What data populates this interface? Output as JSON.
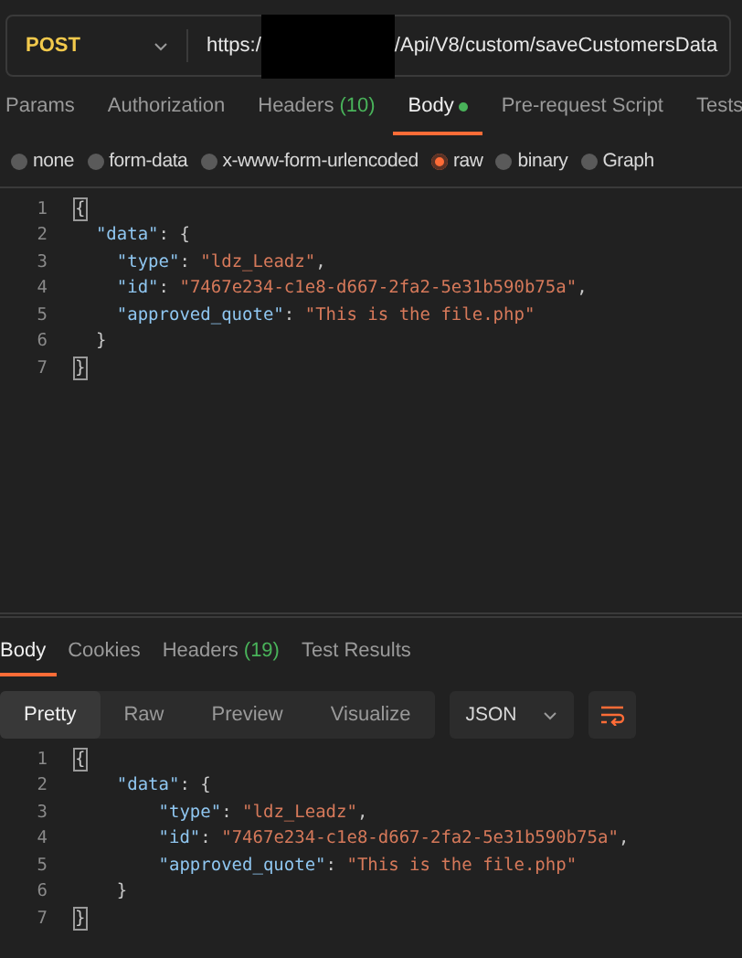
{
  "request": {
    "method": "POST",
    "url_prefix": "https:/",
    "url_suffix": "/Api/V8/custom/saveCustomersData"
  },
  "request_tabs": [
    {
      "label": "Params",
      "selected": false
    },
    {
      "label": "Authorization",
      "selected": false
    },
    {
      "label": "Headers",
      "count": "(10)",
      "selected": false
    },
    {
      "label": "Body",
      "selected": true,
      "dot": true
    },
    {
      "label": "Pre-request Script",
      "selected": false
    },
    {
      "label": "Tests",
      "selected": false
    }
  ],
  "body_types": [
    {
      "label": "none",
      "selected": false
    },
    {
      "label": "form-data",
      "selected": false
    },
    {
      "label": "x-www-form-urlencoded",
      "selected": false
    },
    {
      "label": "raw",
      "selected": true
    },
    {
      "label": "binary",
      "selected": false
    },
    {
      "label": "Graph",
      "selected": false
    }
  ],
  "request_body": [
    {
      "number": "1",
      "tokens": [
        {
          "kind": "match",
          "text": "{"
        }
      ]
    },
    {
      "number": "2",
      "tokens": [
        {
          "kind": "key",
          "text": "\"data\""
        },
        {
          "kind": "plain",
          "text": ": {"
        }
      ]
    },
    {
      "number": "3",
      "tokens": [
        {
          "kind": "key",
          "text": "\"type\""
        },
        {
          "kind": "plain",
          "text": ": "
        },
        {
          "kind": "string",
          "text": "\"ldz_Leadz\""
        },
        {
          "kind": "plain",
          "text": ","
        }
      ]
    },
    {
      "number": "4",
      "tokens": [
        {
          "kind": "key",
          "text": "\"id\""
        },
        {
          "kind": "plain",
          "text": ": "
        },
        {
          "kind": "string",
          "text": "\"7467e234-c1e8-d667-2fa2-5e31b590b75a\""
        },
        {
          "kind": "plain",
          "text": ","
        }
      ]
    },
    {
      "number": "5",
      "tokens": [
        {
          "kind": "key",
          "text": "\"approved_quote\""
        },
        {
          "kind": "plain",
          "text": ": "
        },
        {
          "kind": "string",
          "text": "\"This is the file.php\""
        }
      ]
    },
    {
      "number": "6",
      "tokens": [
        {
          "kind": "plain",
          "text": "}"
        }
      ]
    },
    {
      "number": "7",
      "tokens": [
        {
          "kind": "match",
          "text": "}"
        }
      ]
    }
  ],
  "response_tabs": [
    {
      "label": "Body",
      "selected": true
    },
    {
      "label": "Cookies",
      "selected": false
    },
    {
      "label": "Headers",
      "count": "(19)",
      "selected": false
    },
    {
      "label": "Test Results",
      "selected": false
    }
  ],
  "view_modes": [
    {
      "label": "Pretty",
      "selected": true
    },
    {
      "label": "Raw",
      "selected": false
    },
    {
      "label": "Preview",
      "selected": false
    },
    {
      "label": "Visualize",
      "selected": false
    }
  ],
  "format": "JSON",
  "response_body": [
    {
      "number": "1",
      "tokens": [
        {
          "kind": "match",
          "text": "{"
        }
      ]
    },
    {
      "number": "2",
      "tokens": [
        {
          "kind": "key",
          "text": "\"data\""
        },
        {
          "kind": "plain",
          "text": ": {"
        }
      ]
    },
    {
      "number": "3",
      "tokens": [
        {
          "kind": "key",
          "text": "\"type\""
        },
        {
          "kind": "plain",
          "text": ": "
        },
        {
          "kind": "string",
          "text": "\"ldz_Leadz\""
        },
        {
          "kind": "plain",
          "text": ","
        }
      ]
    },
    {
      "number": "4",
      "tokens": [
        {
          "kind": "key",
          "text": "\"id\""
        },
        {
          "kind": "plain",
          "text": ": "
        },
        {
          "kind": "string",
          "text": "\"7467e234-c1e8-d667-2fa2-5e31b590b75a\""
        },
        {
          "kind": "plain",
          "text": ","
        }
      ]
    },
    {
      "number": "5",
      "tokens": [
        {
          "kind": "key",
          "text": "\"approved_quote\""
        },
        {
          "kind": "plain",
          "text": ": "
        },
        {
          "kind": "string",
          "text": "\"This is the file.php\""
        }
      ]
    },
    {
      "number": "6",
      "tokens": [
        {
          "kind": "plain",
          "text": "}"
        }
      ]
    },
    {
      "number": "7",
      "tokens": [
        {
          "kind": "match",
          "text": "}"
        }
      ]
    }
  ]
}
